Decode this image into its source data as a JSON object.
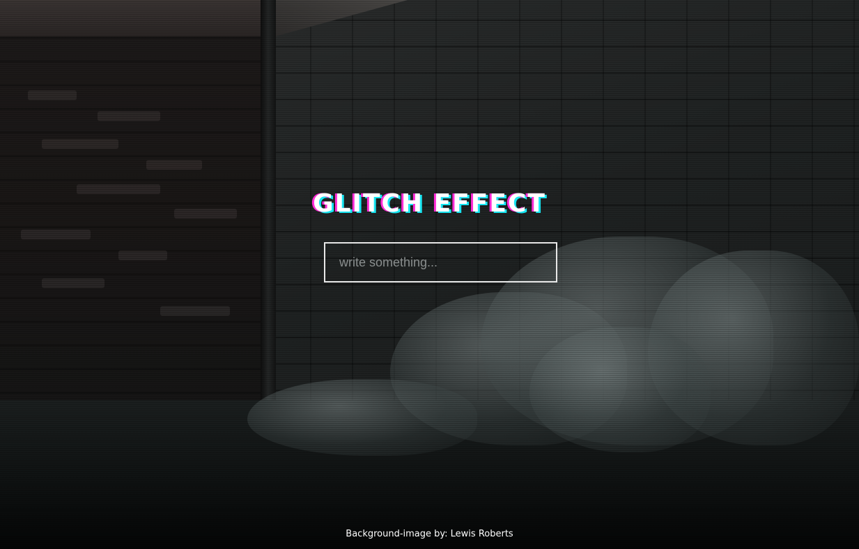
{
  "page": {
    "title": "GLITCH EFFECT",
    "input_placeholder": "write something...",
    "input_value": "",
    "credit": "Background-image by: Lewis Roberts"
  },
  "colors": {
    "title_text": "#ffffff",
    "glitch_magenta": "#ff2bd6",
    "glitch_cyan": "#17e6f2",
    "input_border": "#e8e8e8"
  }
}
